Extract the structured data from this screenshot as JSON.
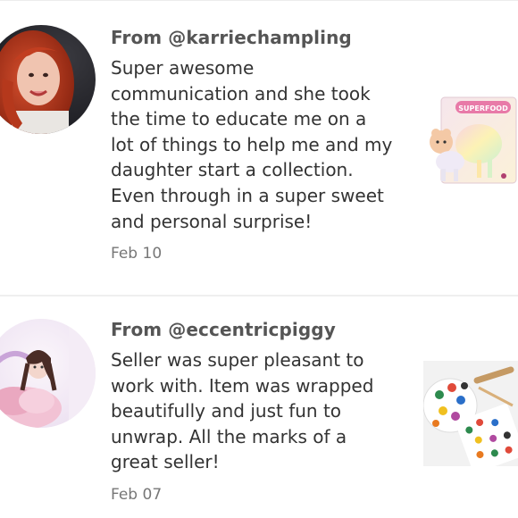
{
  "reviews": [
    {
      "from": "From @karriechampling",
      "text": "Super awesome communication and she took the time to educate me on a lot of things to help me and my daughter start a collection. Even through in a super sweet and personal surprise!",
      "date": "Feb 10",
      "product_box_label": "SUPERFOOD"
    },
    {
      "from": "From @eccentricpiggy",
      "text": "Seller was super pleasant to work with. Item was wrapped beautifully and just fun to unwrap. All the marks of a great seller!",
      "date": "Feb 07"
    }
  ]
}
